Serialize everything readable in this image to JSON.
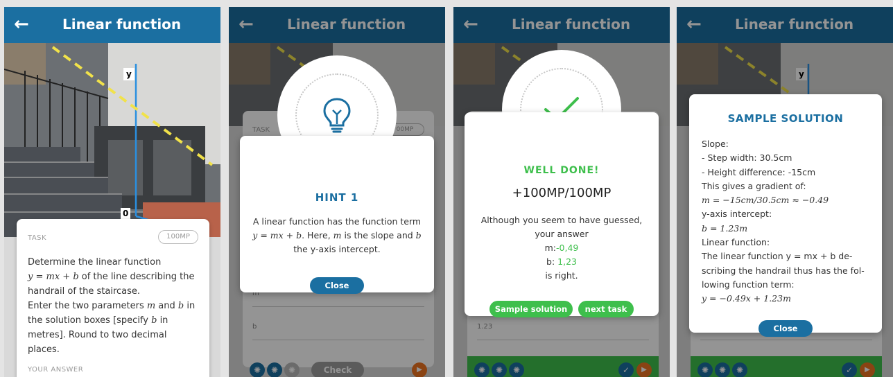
{
  "app": {
    "title": "Linear function",
    "back_icon": "arrow-left-icon"
  },
  "task": {
    "label": "TASK",
    "points": "100MP",
    "points_partial": "00MP",
    "text": {
      "l1": "Determine the linear function",
      "l2_math": "y = mx + b",
      "l2": " of the line describing the",
      "l3": "handrail of the staircase.",
      "l4a": "Enter the two parameters ",
      "l4m": "m",
      "l4b": " and ",
      "l4c": "b",
      "l4d": " in",
      "l5a": "the solution boxes [specify ",
      "l5m": "b",
      "l5b": " in",
      "l6": "metres]. Round to two decimal places."
    },
    "answer_label": "YOUR ANSWER"
  },
  "photo": {
    "y_axis_label": "y",
    "origin_label": "0"
  },
  "answer_fields": {
    "m_label": "m",
    "b_label": "b",
    "b_value": "1.23"
  },
  "bottom": {
    "check_label": "Check"
  },
  "hint": {
    "title": "HINT 1",
    "l1": "A linear function has the function term",
    "l2_math": "y = mx + b",
    "l2a": ". Here, ",
    "l2m": "m",
    "l2b": " is the slope and ",
    "l2c": "b",
    "l3": "the y-axis intercept.",
    "close": "Close"
  },
  "result": {
    "title": "WELL DONE!",
    "score": "+100MP/100MP",
    "l1": "Although you seem to have guessed,",
    "l2": "your answer",
    "m_label": "m:",
    "m_value": "-0,49",
    "b_label": "b: ",
    "b_value": "1,23",
    "l5": "is right.",
    "sample_btn": "Sample solution",
    "next_btn": "next task"
  },
  "solution": {
    "title": "SAMPLE SOLUTION",
    "lines": [
      "Slope:",
      "- Step width: 30.5cm",
      "- Height difference: -15cm",
      "This gives a gradient of:",
      "m = −15cm/30.5cm ≈ −0.49",
      "y-axis intercept:",
      "b = 1.23m",
      "Linear function:",
      "The linear function y = mx + b de-",
      "scribing the handrail thus has the fol-",
      "lowing function term:",
      "y = −0.49x + 1.23m"
    ],
    "close": "Close"
  },
  "colors": {
    "primary": "#1b6fa1",
    "success": "#3ebf4c",
    "skip": "#ee7422"
  }
}
